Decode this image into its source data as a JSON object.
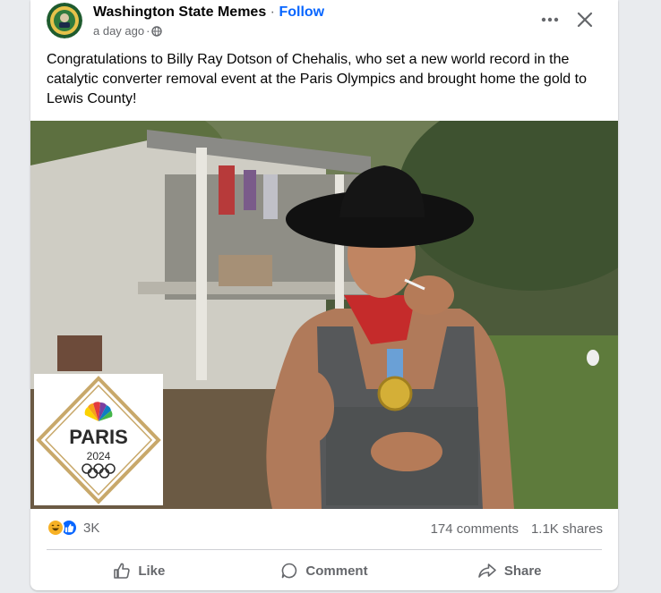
{
  "post": {
    "page_name": "Washington State Memes",
    "separator": "·",
    "follow_label": "Follow",
    "timestamp": "a day ago",
    "meta_separator": "·",
    "privacy_icon": "globe-icon",
    "more_icon": "more-options-icon",
    "close_icon": "close-icon",
    "text": "Congratulations to Billy Ray Dotson of Chehalis, who set a new world record in the catalytic converter removal event at the Paris Olympics and brought home the gold to Lewis County!"
  },
  "media": {
    "overlay_logo": {
      "line1": "PARIS",
      "line2": "2024"
    }
  },
  "engagement": {
    "reactions": [
      "haha",
      "like"
    ],
    "reaction_count": "3K",
    "comments": "174 comments",
    "shares": "1.1K shares"
  },
  "actions": {
    "like": "Like",
    "comment": "Comment",
    "share": "Share"
  },
  "colors": {
    "accent": "#0866ff",
    "secondary_text": "#65676b",
    "background": "#e9ebee",
    "card": "#ffffff"
  }
}
